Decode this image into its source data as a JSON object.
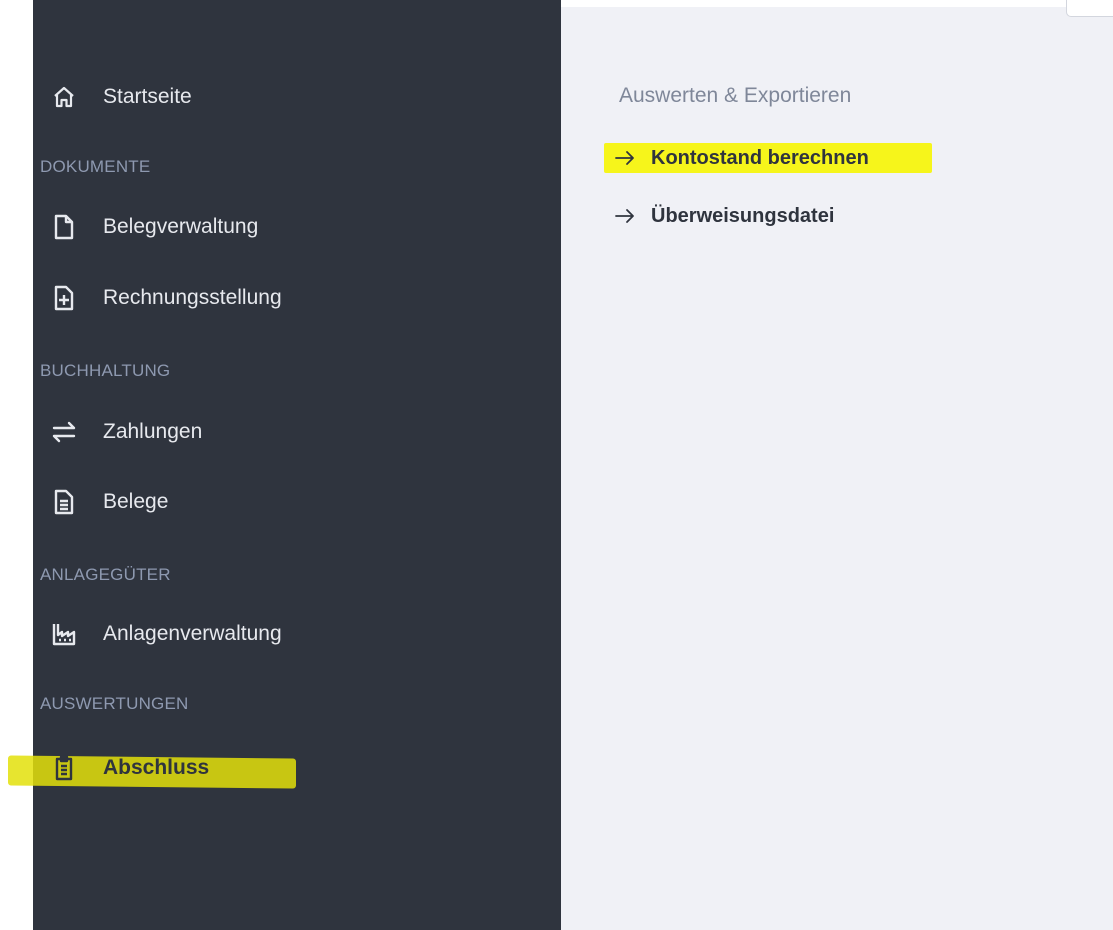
{
  "sidebar": {
    "home": {
      "label": "Startseite",
      "icon": "home-icon"
    },
    "sections": [
      {
        "title": "DOKUMENTE",
        "items": [
          {
            "label": "Belegverwaltung",
            "icon": "file-icon"
          },
          {
            "label": "Rechnungsstellung",
            "icon": "file-plus-icon"
          }
        ]
      },
      {
        "title": "BUCHHALTUNG",
        "items": [
          {
            "label": "Zahlungen",
            "icon": "transfer-arrows-icon"
          },
          {
            "label": "Belege",
            "icon": "document-lines-icon"
          }
        ]
      },
      {
        "title": "ANLAGEGÜTER",
        "items": [
          {
            "label": "Anlagenverwaltung",
            "icon": "factory-icon"
          }
        ]
      },
      {
        "title": "AUSWERTUNGEN",
        "items": [
          {
            "label": "Abschluss",
            "icon": "clipboard-list-icon",
            "active": true
          }
        ]
      }
    ]
  },
  "main": {
    "heading": "Auswerten & Exportieren",
    "links": [
      {
        "label": "Kontostand berechnen",
        "icon": "arrow-right-icon",
        "highlighted": true
      },
      {
        "label": "Überweisungsdatei",
        "icon": "arrow-right-icon"
      }
    ]
  },
  "colors": {
    "sidebar_bg": "#2f343e",
    "main_bg": "#f0f1f6",
    "highlight": "#f6f51b",
    "section_title": "#8e99b0",
    "nav_text": "#e7e9ee"
  }
}
